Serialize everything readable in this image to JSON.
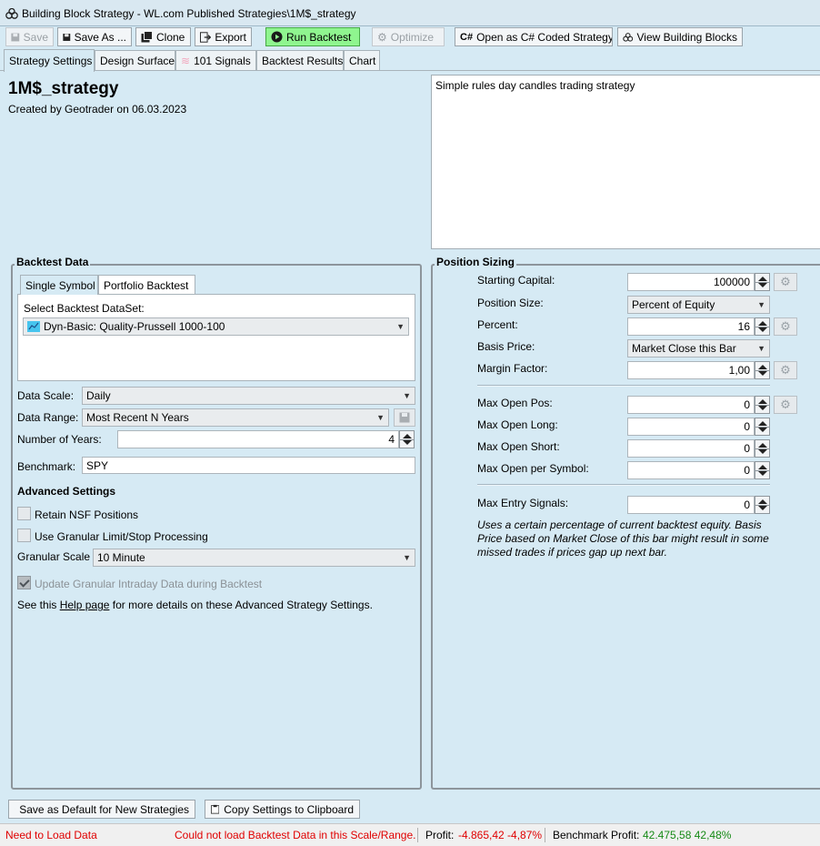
{
  "window": {
    "title": "Building Block Strategy - WL.com Published Strategies\\1M$_strategy"
  },
  "toolbar": {
    "save": "Save",
    "save_as": "Save As ...",
    "clone": "Clone",
    "export": "Export",
    "run_backtest": "Run Backtest",
    "optimize": "Optimize",
    "open_csharp": "Open as C# Coded Strategy",
    "view_blocks": "View Building Blocks",
    "csharp_glyph": "C#"
  },
  "tabs": [
    {
      "label": "Strategy Settings",
      "active": true
    },
    {
      "label": "Design Surface"
    },
    {
      "label": "101 Signals"
    },
    {
      "label": "Backtest Results"
    },
    {
      "label": "Chart"
    }
  ],
  "strategy": {
    "name": "1M$_strategy",
    "created": "Created by Geotrader on 06.03.2023",
    "description": "Simple rules day candles trading strategy"
  },
  "backtest_data": {
    "title": "Backtest Data",
    "subtabs": [
      "Single Symbol",
      "Portfolio Backtest"
    ],
    "dataset_label": "Select Backtest DataSet:",
    "dataset_value": "Dyn-Basic: Quality-Prussell 1000-100",
    "data_scale_label": "Data Scale:",
    "data_scale_value": "Daily",
    "data_range_label": "Data Range:",
    "data_range_value": "Most Recent N Years",
    "years_label": "Number of Years:",
    "years_value": "4",
    "benchmark_label": "Benchmark:",
    "benchmark_value": "SPY"
  },
  "advanced": {
    "title": "Advanced Settings",
    "retain_nsf": "Retain NSF Positions",
    "granular_processing": "Use Granular Limit/Stop Processing",
    "granular_scale_label": "Granular Scale",
    "granular_scale_value": "10 Minute",
    "update_granular": "Update Granular Intraday Data during Backtest",
    "help_prefix": "See this",
    "help_link": "Help page",
    "help_suffix": "for more details on these Advanced Strategy Settings."
  },
  "position_sizing": {
    "title": "Position Sizing",
    "starting_capital_label": "Starting Capital:",
    "starting_capital_value": "100000",
    "position_size_label": "Position Size:",
    "position_size_value": "Percent of Equity",
    "percent_label": "Percent:",
    "percent_value": "16",
    "basis_price_label": "Basis Price:",
    "basis_price_value": "Market Close this Bar",
    "margin_factor_label": "Margin Factor:",
    "margin_factor_value": "1,00",
    "max_open_pos_label": "Max Open Pos:",
    "max_open_pos_value": "0",
    "max_open_long_label": "Max Open Long:",
    "max_open_long_value": "0",
    "max_open_short_label": "Max Open Short:",
    "max_open_short_value": "0",
    "max_open_symbol_label": "Max Open per Symbol:",
    "max_open_symbol_value": "0",
    "max_entry_label": "Max Entry Signals:",
    "max_entry_value": "0",
    "note_line1": "Uses a certain percentage of current backtest equity. Basis",
    "note_line2": "Price based on Market Close of this bar might result in some",
    "note_line3": "missed trades if prices gap up next bar."
  },
  "bottom": {
    "save_default": "Save as Default for New Strategies",
    "copy_settings": "Copy Settings to Clipboard"
  },
  "status": {
    "need_load": "Need to Load Data",
    "could_not_load": "Could not load Backtest Data in this Scale/Range.",
    "profit_label": "Profit:",
    "profit_value": "-4.865,42 -4,87%",
    "benchmark_label": "Benchmark Profit:",
    "benchmark_value": "42.475,58 42,48%"
  },
  "colors": {
    "background": "#d6eaf4",
    "run_button": "#8ff58f",
    "error_red": "#e00000",
    "profit_green": "#168a16"
  }
}
